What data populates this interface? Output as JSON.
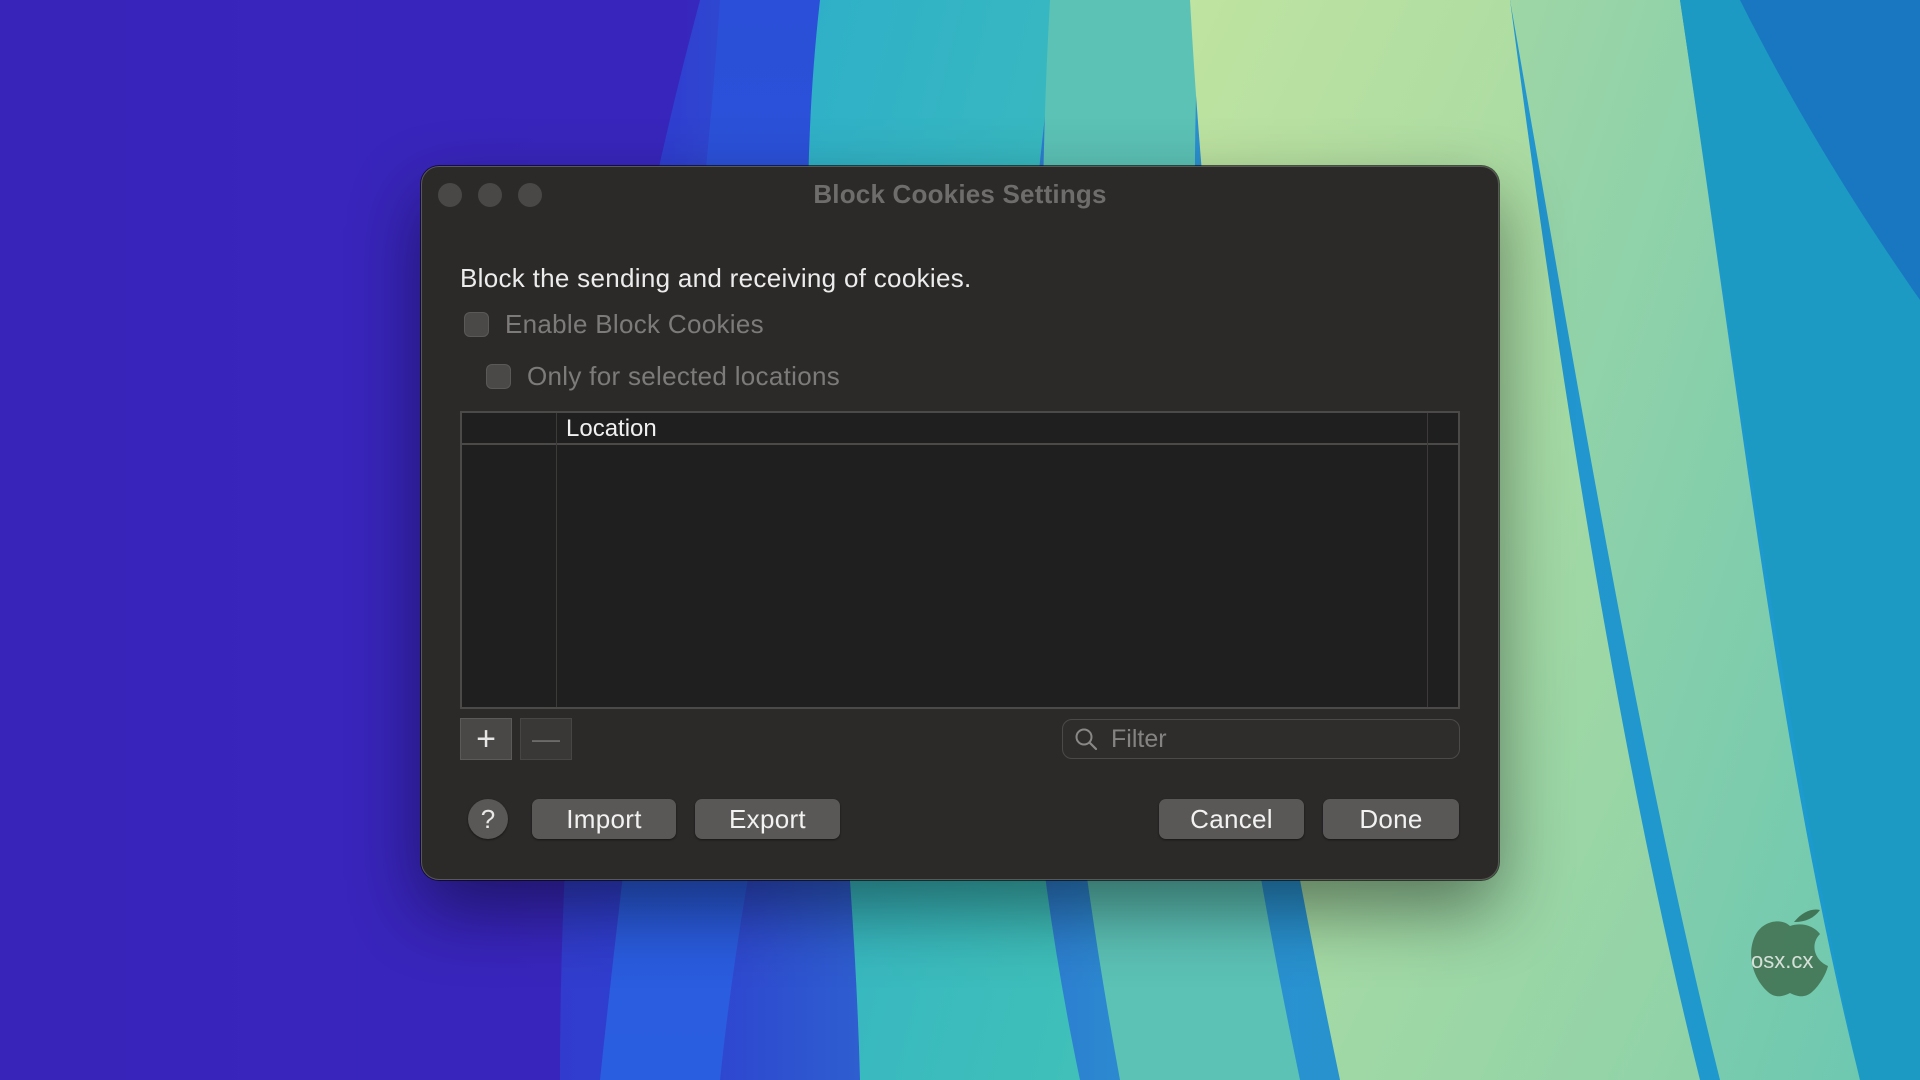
{
  "colors": {
    "window_bg": "#2c2a29",
    "table_bg": "#1f1f1f",
    "button_bg": "#5a5856",
    "disabled_text": "#7d7b79"
  },
  "window": {
    "title": "Block Cookies Settings",
    "controls": [
      "close",
      "minimize",
      "zoom"
    ]
  },
  "description": "Block the sending and receiving of cookies.",
  "checkboxes": {
    "enable_label": "Enable Block Cookies",
    "enable_checked": false,
    "only_selected_label": "Only for selected locations",
    "only_selected_checked": false
  },
  "table": {
    "columns": [
      "",
      "Location",
      ""
    ],
    "rows": []
  },
  "list_controls": {
    "add_label": "+",
    "remove_label": "—"
  },
  "filter": {
    "placeholder": "Filter",
    "value": "",
    "icon": "search-icon"
  },
  "buttons": {
    "help_label": "?",
    "import_label": "Import",
    "export_label": "Export",
    "cancel_label": "Cancel",
    "done_label": "Done"
  },
  "watermark": {
    "text": "osx.cx"
  }
}
